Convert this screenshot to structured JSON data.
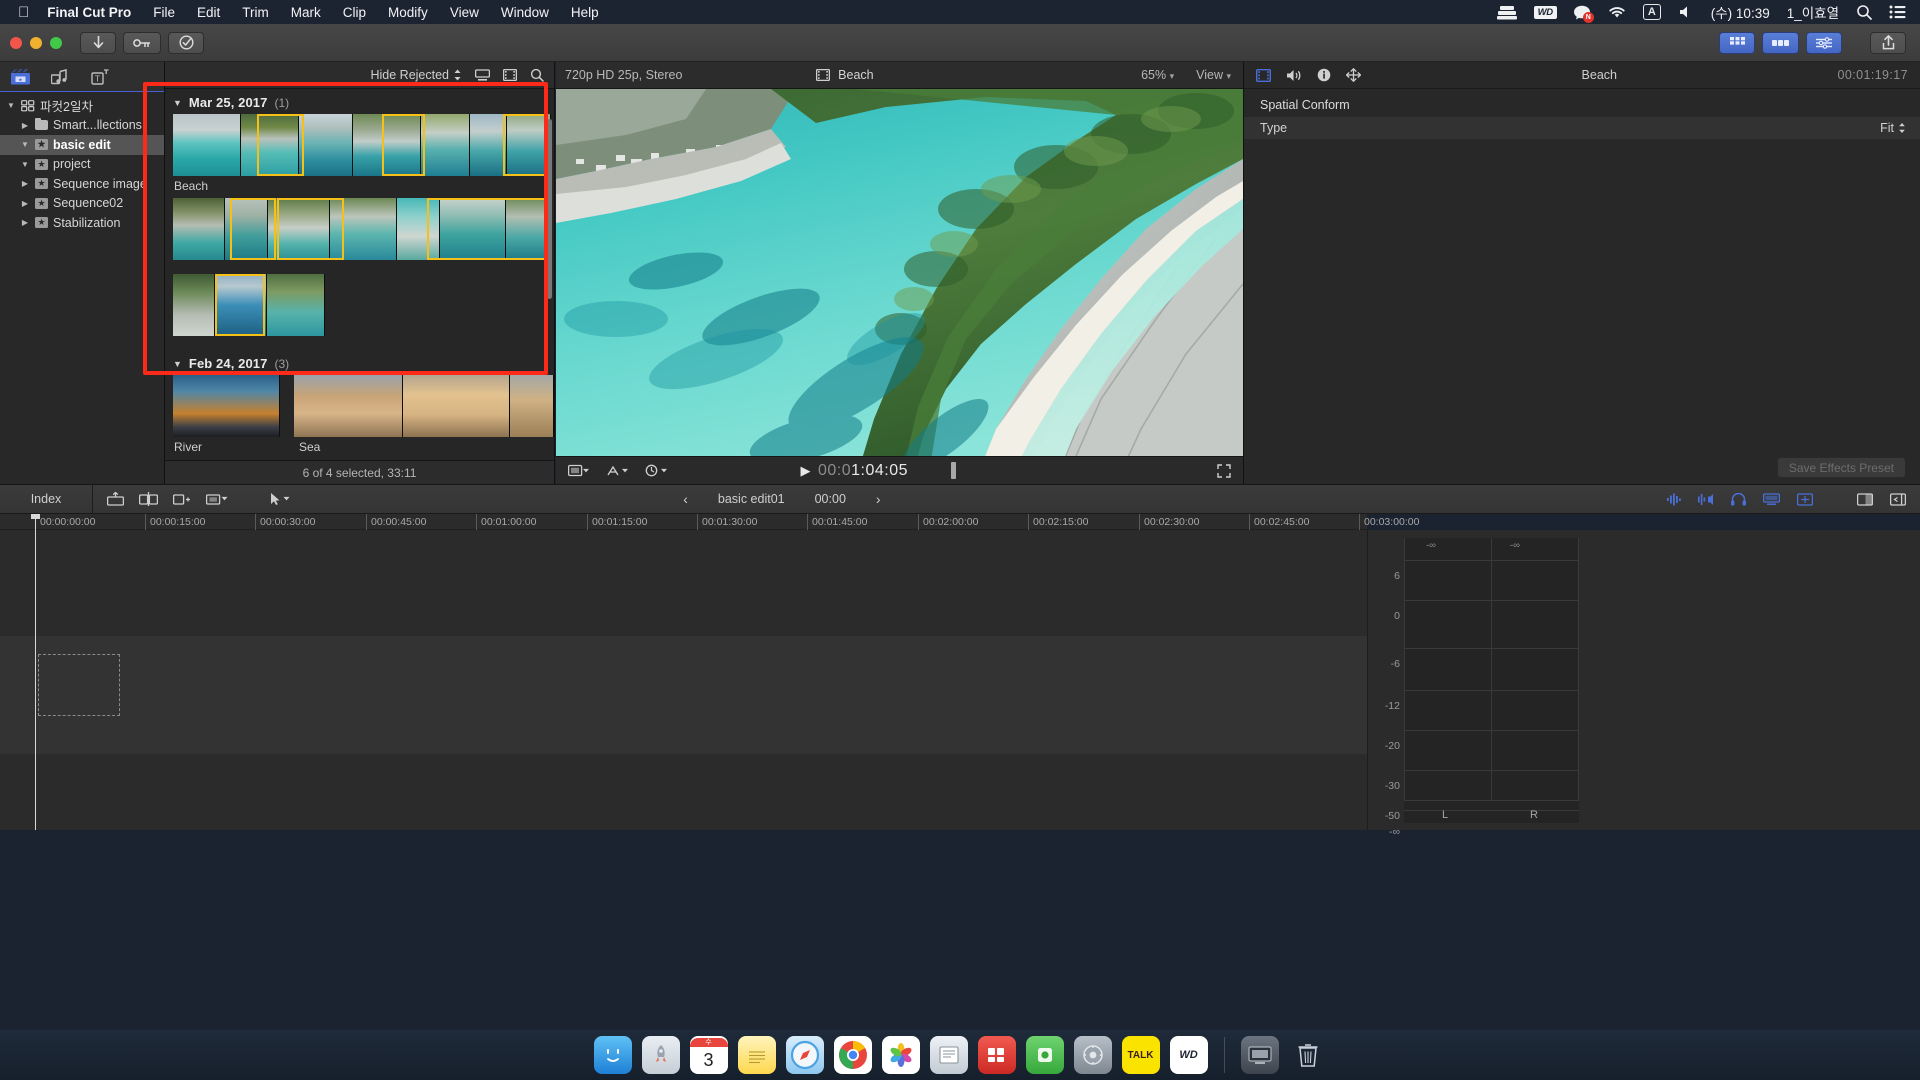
{
  "menubar": {
    "apple_icon": "apple-logo-icon",
    "app_name": "Final Cut Pro",
    "items": [
      "File",
      "Edit",
      "Trim",
      "Mark",
      "Clip",
      "Modify",
      "View",
      "Window",
      "Help"
    ],
    "status": {
      "drive_icon": "external-drive-icon",
      "wd_label": "WD",
      "chat_icon": "chat-bubble-icon",
      "chat_badge": "N",
      "wifi_icon": "wifi-icon",
      "input_source": "A",
      "volume_icon": "volume-icon",
      "clock": "(수) 10:39",
      "user": "1_이효열",
      "search_icon": "spotlight-search-icon",
      "control_center_icon": "control-center-icon"
    }
  },
  "toolbar": {
    "import_icon": "import-media-icon",
    "keyword_icon": "keyword-editor-icon",
    "analyze_icon": "analyze-check-icon",
    "right_buttons": [
      "browser-view-icon",
      "timeline-index-icon",
      "inspector-icon"
    ],
    "share_icon": "share-export-icon"
  },
  "sidebar": {
    "tabs": [
      {
        "name": "libraries-tab",
        "icon": "film-clapper-icon",
        "active": true
      },
      {
        "name": "photos-audio-tab",
        "icon": "music-photo-icon",
        "active": false
      },
      {
        "name": "titles-generators-tab",
        "icon": "titles-generators-icon",
        "active": false
      }
    ],
    "items": [
      {
        "label": "파컷2일차",
        "level": 0,
        "disclosure": "open",
        "icon": "library-events-icon",
        "selected": false
      },
      {
        "label": "Smart...llections",
        "level": 1,
        "disclosure": "closed",
        "icon": "folder-icon",
        "selected": false
      },
      {
        "label": "basic edit",
        "level": 1,
        "disclosure": "open",
        "icon": "event-star-icon",
        "selected": true
      },
      {
        "label": "project",
        "level": 1,
        "disclosure": "open",
        "icon": "event-star-icon",
        "selected": false
      },
      {
        "label": "Sequence image",
        "level": 1,
        "disclosure": "closed",
        "icon": "event-star-icon",
        "selected": false
      },
      {
        "label": "Sequence02",
        "level": 1,
        "disclosure": "closed",
        "icon": "event-star-icon",
        "selected": false
      },
      {
        "label": "Stabilization",
        "level": 1,
        "disclosure": "closed",
        "icon": "event-star-icon",
        "selected": false
      }
    ]
  },
  "browser": {
    "filter_label": "Hide Rejected",
    "filter_chevron": "updown-chevron-icon",
    "clip_appearance_icon": "clip-appearance-icon",
    "filmstrip_icon": "filmstrip-view-icon",
    "search_icon": "search-icon",
    "groups": [
      {
        "date": "Mar 25, 2017",
        "count": "(1)",
        "clips": [
          {
            "name": "Beach",
            "selection_count": 3
          },
          {
            "name": "",
            "selection_count": 2
          },
          {
            "name": "",
            "selection_count": 1
          }
        ]
      },
      {
        "date": "Feb 24, 2017",
        "count": "(3)",
        "clips": [
          {
            "name": "River",
            "selection_count": 0
          },
          {
            "name": "Sea",
            "selection_count": 0
          }
        ]
      }
    ],
    "status": "6 of 4 selected, 33:11"
  },
  "viewer": {
    "format": "720p HD 25p, Stereo",
    "clip_icon": "filmstrip-icon",
    "clip_name": "Beach",
    "zoom": "65%",
    "view_label": "View",
    "transform_icon": "transform-tools-icon",
    "effects_icon": "effects-toggle-icon",
    "timing_icon": "playback-quality-icon",
    "play_icon": "play-triangle-icon",
    "timecode_prefix": "00:0",
    "timecode_main": "1:04:05",
    "fullscreen_icon": "fullscreen-icon"
  },
  "inspector": {
    "tabs": [
      "video-tab-icon",
      "audio-tab-icon",
      "info-tab-icon",
      "share-tab-icon"
    ],
    "title": "Beach",
    "duration": "00:01:19:17",
    "section": "Spatial Conform",
    "rows": [
      {
        "label": "Type",
        "value": "Fit",
        "chevron": "updown-chevron-icon"
      }
    ],
    "save_effects_label": "Save Effects Preset"
  },
  "timeline": {
    "index_label": "Index",
    "tools": [
      "connect-clip-icon",
      "insert-clip-icon",
      "append-clip-icon",
      "overwrite-clip-icon",
      "select-tool-icon"
    ],
    "prev_icon": "previous-chevron-icon",
    "next_icon": "next-chevron-icon",
    "project_name": "basic edit01",
    "project_time": "00:00",
    "right_tools": [
      "audio-skimming-icon",
      "solo-icon",
      "headphones-icon",
      "clip-appearance-icon",
      "zoom-timeline-icon",
      "detach-window-icon",
      "hide-panel-icon"
    ],
    "ruler_ticks": [
      "00:00:00:00",
      "00:00:15:00",
      "00:00:30:00",
      "00:00:45:00",
      "00:01:00:00",
      "00:01:15:00",
      "00:01:30:00",
      "00:01:45:00",
      "00:02:00:00",
      "00:02:15:00",
      "00:02:30:00",
      "00:02:45:00",
      "00:03:00:00"
    ]
  },
  "meters": {
    "scale": [
      "6",
      "0",
      "-6",
      "-12",
      "-20",
      "-30",
      "-50",
      "-∞"
    ],
    "top_labels": [
      "-∞",
      "-∞"
    ],
    "channels": [
      "L",
      "R"
    ]
  },
  "dock": {
    "icons": [
      {
        "name": "finder-icon",
        "glyph": "☺",
        "color": "#2b8ef5"
      },
      {
        "name": "launchpad-icon",
        "glyph": "🚀",
        "color": "#d8dde3"
      },
      {
        "name": "calendar-icon",
        "glyph": "3",
        "color": "#ffffff"
      },
      {
        "name": "notes-icon",
        "glyph": "▤",
        "color": "#ffd84d"
      },
      {
        "name": "safari-icon",
        "glyph": "🧭",
        "color": "#2fa5f2"
      },
      {
        "name": "chrome-icon",
        "glyph": "◉",
        "color": "#f4f4f4"
      },
      {
        "name": "photos-icon",
        "glyph": "❋",
        "color": "#fafafa"
      },
      {
        "name": "reader-icon",
        "glyph": "▦",
        "color": "#d9dee4"
      },
      {
        "name": "redapp-icon",
        "glyph": "▥",
        "color": "#e03b35"
      },
      {
        "name": "greenapp-icon",
        "glyph": "▣",
        "color": "#4bb94b"
      },
      {
        "name": "settings-icon",
        "glyph": "⚙",
        "color": "#9aa3ad"
      },
      {
        "name": "kakaotalk-icon",
        "glyph": "TALK",
        "color": "#fbe300"
      },
      {
        "name": "wd-utility-icon",
        "glyph": "WD",
        "color": "#ffffff"
      },
      {
        "name": "screenshot-icon",
        "glyph": "▭",
        "color": "#b9c0c8"
      },
      {
        "name": "trash-icon",
        "glyph": "🗑",
        "color": "#c9d0d8"
      }
    ]
  },
  "colors": {
    "accent_blue": "#4a6fd8",
    "selection_yellow": "#f5c018",
    "annotation_red": "#fc2b19",
    "panel_bg": "#282828"
  }
}
